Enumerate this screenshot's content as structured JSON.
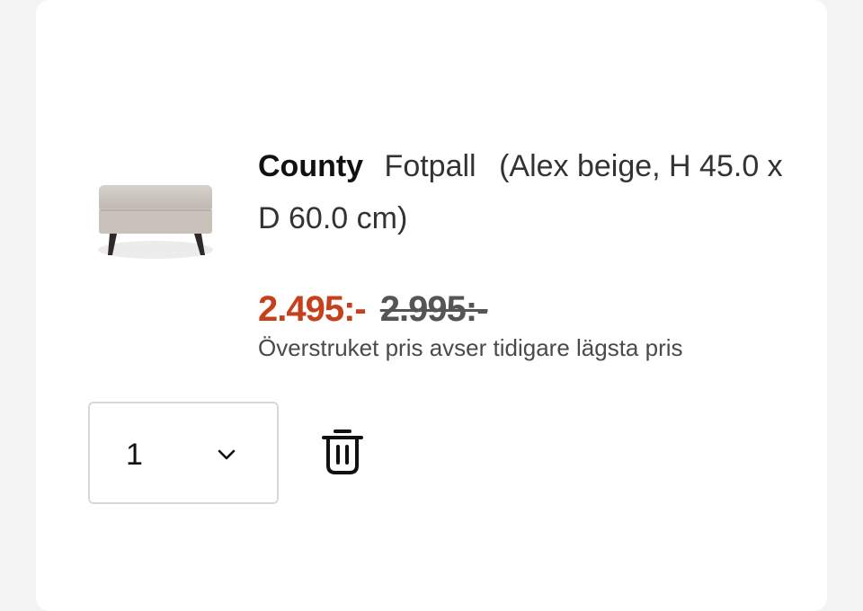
{
  "product": {
    "brand": "County",
    "type": "Fotpall",
    "spec": "(Alex beige, H 45.0 x D 60.0 cm)",
    "image_icon": "ottoman-footstool-thumbnail"
  },
  "pricing": {
    "current": "2.495:-",
    "previous": "2.995:-",
    "note": "Överstruket pris avser tidigare lägsta pris",
    "current_color": "#c5411c"
  },
  "quantity": {
    "value": "1",
    "icon": "chevron-down-icon"
  },
  "actions": {
    "remove_icon": "trash-icon"
  }
}
